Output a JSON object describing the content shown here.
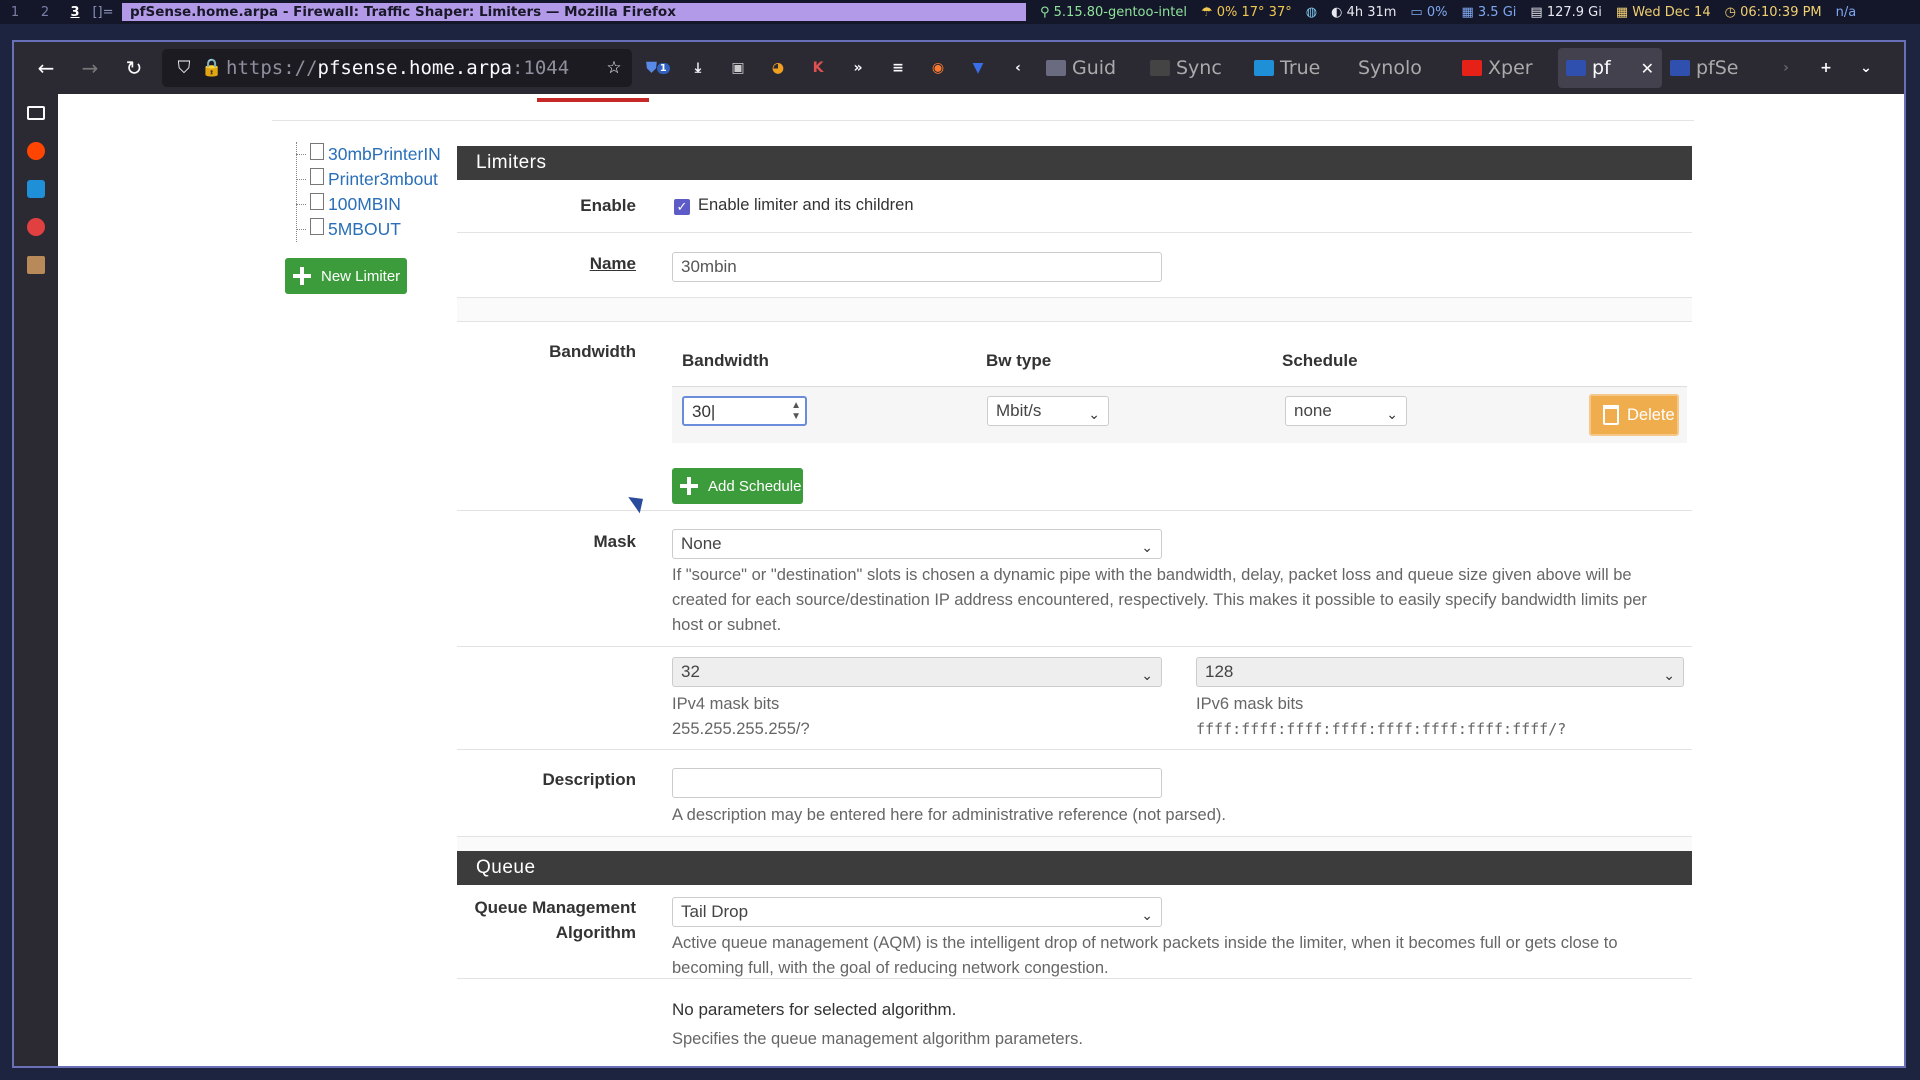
{
  "wm": {
    "workspaces": [
      "1",
      "2",
      "3"
    ],
    "layout_symbol": "[]=",
    "window_title": "pfSense.home.arpa - Firewall: Traffic Shaper: Limiters — Mozilla Firefox",
    "status": {
      "kernel": "5.15.80-gentoo-intel",
      "temps": "0% 17° 37°",
      "vpn": "",
      "battery": "4h 31m",
      "cpu": "0%",
      "memory": "3.5 Gi",
      "disk": "127.9 Gi",
      "date": "Wed Dec 14",
      "time": "06:10:39 PM",
      "na": "n/a"
    }
  },
  "browser": {
    "url_prefix": "https://",
    "url_host": "pfsense.home.arpa",
    "url_rest": ":1044",
    "extension_badge": "1",
    "tabs": [
      {
        "label": "Guid",
        "color": "#6a6a80"
      },
      {
        "label": "Sync",
        "color": "#444"
      },
      {
        "label": "True",
        "color": "#1f8fd8"
      },
      {
        "label": "Synolo",
        "color": "#2b2a33"
      },
      {
        "label": "Xper",
        "color": "#e62117"
      },
      {
        "label": "pf",
        "color": "#3050b0",
        "selected": true
      },
      {
        "label": "pfSe",
        "color": "#3050b0"
      }
    ]
  },
  "sidebar_colors": [
    "#fbfbfe",
    "#ff4500",
    "#1f8fd8",
    "#e04040",
    "#b88a5a"
  ],
  "tree": {
    "items": [
      "30mbPrinterIN",
      "Printer3mbout",
      "100MBIN",
      "5MBOUT"
    ],
    "new_limiter_label": "New Limiter"
  },
  "limiters": {
    "heading": "Limiters",
    "enable_label": "Enable",
    "enable_text": "Enable limiter and its children",
    "enable_checked": true,
    "name_label": "Name",
    "name_value": "30mbin",
    "bandwidth_label": "Bandwidth",
    "col_bandwidth": "Bandwidth",
    "col_bwtype": "Bw type",
    "col_schedule": "Schedule",
    "bandwidth_value": "30",
    "bwtype_value": "Mbit/s",
    "schedule_value": "none",
    "delete_label": "Delete",
    "add_schedule_label": "Add Schedule",
    "mask_label": "Mask",
    "mask_value": "None",
    "mask_help": "If \"source\" or \"destination\" slots is chosen a dynamic pipe with the bandwidth, delay, packet loss and queue size given above will be created for each source/destination IP address encountered, respectively. This makes it possible to easily specify bandwidth limits per host or subnet.",
    "ipv4_bits": "32",
    "ipv4_label": "IPv4 mask bits",
    "ipv4_mask": "255.255.255.255/?",
    "ipv6_bits": "128",
    "ipv6_label": "IPv6 mask bits",
    "ipv6_mask": "ffff:ffff:ffff:ffff:ffff:ffff:ffff:ffff/?",
    "description_label": "Description",
    "description_value": "",
    "description_help": "A description may be entered here for administrative reference (not parsed)."
  },
  "queue": {
    "heading": "Queue",
    "qma_label": "Queue Management Algorithm",
    "qma_value": "Tail Drop",
    "qma_help": "Active queue management (AQM) is the intelligent drop of network packets inside the limiter, when it becomes full or gets close to becoming full, with the goal of reducing network congestion.",
    "params_text": "No parameters for selected algorithm.",
    "params_help": "Specifies the queue management algorithm parameters."
  }
}
